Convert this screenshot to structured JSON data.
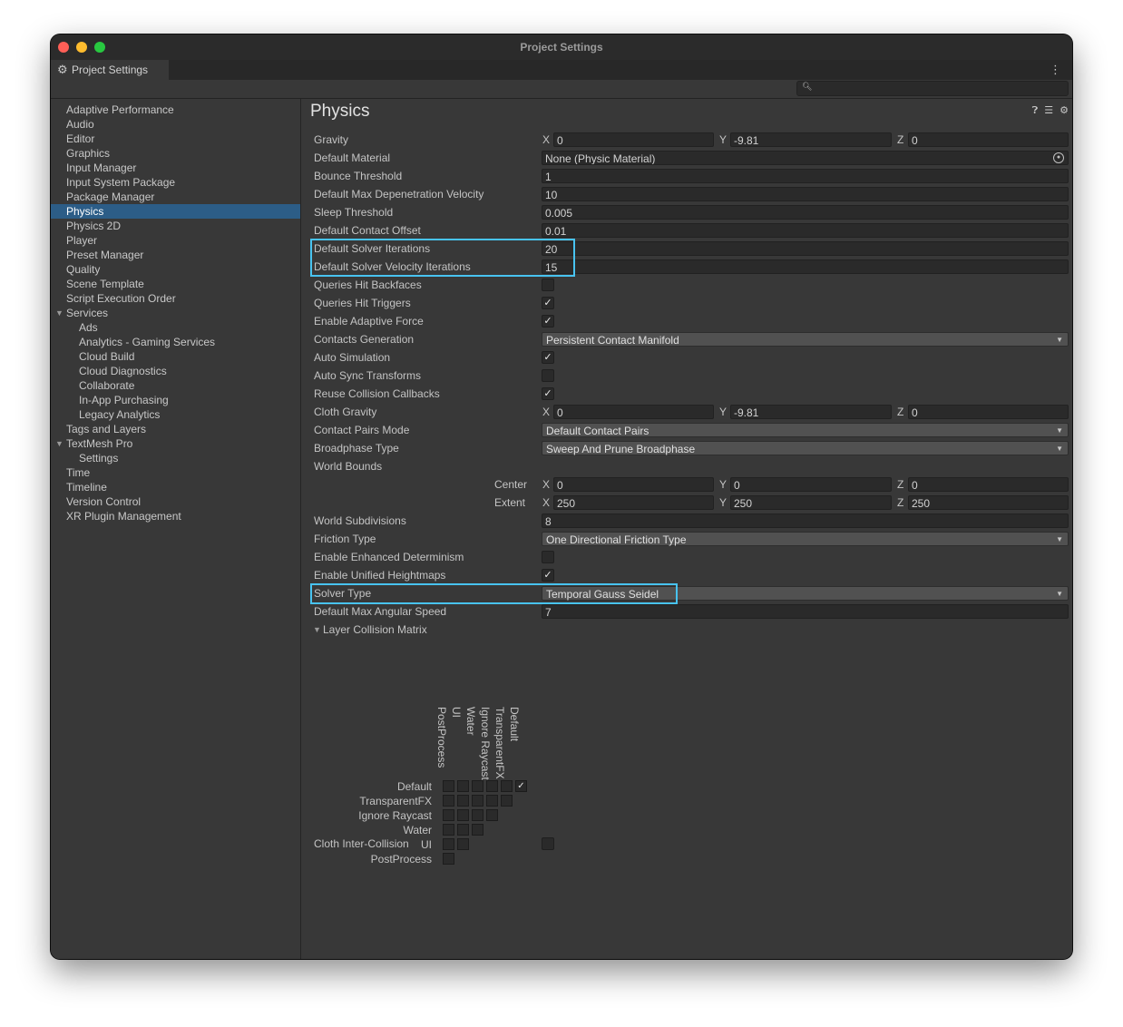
{
  "window": {
    "title": "Project Settings",
    "tab_label": "Project Settings"
  },
  "search": {
    "placeholder": ""
  },
  "sidebar": {
    "items": [
      {
        "label": "Adaptive Performance",
        "indent": 0
      },
      {
        "label": "Audio",
        "indent": 0
      },
      {
        "label": "Editor",
        "indent": 0
      },
      {
        "label": "Graphics",
        "indent": 0
      },
      {
        "label": "Input Manager",
        "indent": 0
      },
      {
        "label": "Input System Package",
        "indent": 0
      },
      {
        "label": "Package Manager",
        "indent": 0
      },
      {
        "label": "Physics",
        "indent": 0,
        "selected": true
      },
      {
        "label": "Physics 2D",
        "indent": 0
      },
      {
        "label": "Player",
        "indent": 0
      },
      {
        "label": "Preset Manager",
        "indent": 0
      },
      {
        "label": "Quality",
        "indent": 0
      },
      {
        "label": "Scene Template",
        "indent": 0
      },
      {
        "label": "Script Execution Order",
        "indent": 0
      },
      {
        "label": "Services",
        "indent": 0,
        "expanded": true
      },
      {
        "label": "Ads",
        "indent": 1
      },
      {
        "label": "Analytics - Gaming Services",
        "indent": 1
      },
      {
        "label": "Cloud Build",
        "indent": 1
      },
      {
        "label": "Cloud Diagnostics",
        "indent": 1
      },
      {
        "label": "Collaborate",
        "indent": 1
      },
      {
        "label": "In-App Purchasing",
        "indent": 1
      },
      {
        "label": "Legacy Analytics",
        "indent": 1
      },
      {
        "label": "Tags and Layers",
        "indent": 0
      },
      {
        "label": "TextMesh Pro",
        "indent": 0,
        "expanded": true
      },
      {
        "label": "Settings",
        "indent": 1
      },
      {
        "label": "Time",
        "indent": 0
      },
      {
        "label": "Timeline",
        "indent": 0
      },
      {
        "label": "Version Control",
        "indent": 0
      },
      {
        "label": "XR Plugin Management",
        "indent": 0
      }
    ]
  },
  "main": {
    "title": "Physics",
    "gravity": {
      "label": "Gravity",
      "x": "0",
      "y": "-9.81",
      "z": "0"
    },
    "default_material": {
      "label": "Default Material",
      "value": "None (Physic Material)"
    },
    "bounce_threshold": {
      "label": "Bounce Threshold",
      "value": "1"
    },
    "max_depenetration": {
      "label": "Default Max Depenetration Velocity",
      "value": "10"
    },
    "sleep_threshold": {
      "label": "Sleep Threshold",
      "value": "0.005"
    },
    "contact_offset": {
      "label": "Default Contact Offset",
      "value": "0.01"
    },
    "solver_iterations": {
      "label": "Default Solver Iterations",
      "value": "20"
    },
    "solver_velocity_iterations": {
      "label": "Default Solver Velocity Iterations",
      "value": "15"
    },
    "queries_hit_backfaces": {
      "label": "Queries Hit Backfaces",
      "checked": false
    },
    "queries_hit_triggers": {
      "label": "Queries Hit Triggers",
      "checked": true
    },
    "enable_adaptive_force": {
      "label": "Enable Adaptive Force",
      "checked": true
    },
    "contacts_generation": {
      "label": "Contacts Generation",
      "value": "Persistent Contact Manifold"
    },
    "auto_simulation": {
      "label": "Auto Simulation",
      "checked": true
    },
    "auto_sync_transforms": {
      "label": "Auto Sync Transforms",
      "checked": false
    },
    "reuse_collision_callbacks": {
      "label": "Reuse Collision Callbacks",
      "checked": true
    },
    "cloth_gravity": {
      "label": "Cloth Gravity",
      "x": "0",
      "y": "-9.81",
      "z": "0"
    },
    "contact_pairs_mode": {
      "label": "Contact Pairs Mode",
      "value": "Default Contact Pairs"
    },
    "broadphase_type": {
      "label": "Broadphase Type",
      "value": "Sweep And Prune Broadphase"
    },
    "world_bounds": {
      "label": "World Bounds",
      "center": {
        "label": "Center",
        "x": "0",
        "y": "0",
        "z": "0"
      },
      "extent": {
        "label": "Extent",
        "x": "250",
        "y": "250",
        "z": "250"
      }
    },
    "world_subdivisions": {
      "label": "World Subdivisions",
      "value": "8"
    },
    "friction_type": {
      "label": "Friction Type",
      "value": "One Directional Friction Type"
    },
    "enhanced_determinism": {
      "label": "Enable Enhanced Determinism",
      "checked": false
    },
    "unified_heightmaps": {
      "label": "Enable Unified Heightmaps",
      "checked": true
    },
    "solver_type": {
      "label": "Solver Type",
      "value": "Temporal Gauss Seidel"
    },
    "max_angular_speed": {
      "label": "Default Max Angular Speed",
      "value": "7"
    },
    "layer_collision_matrix": {
      "label": "Layer Collision Matrix",
      "columns": [
        "PostProcess",
        "UI",
        "Water",
        "Ignore Raycast",
        "TransparentFX",
        "Default"
      ],
      "rows": [
        "Default",
        "TransparentFX",
        "Ignore Raycast",
        "Water",
        "UI",
        "PostProcess"
      ],
      "checked": [
        [
          false,
          false,
          false,
          false,
          false,
          true
        ],
        [
          false,
          false,
          false,
          false,
          false
        ],
        [
          false,
          false,
          false,
          false
        ],
        [
          false,
          false,
          false
        ],
        [
          false,
          false
        ],
        [
          false
        ]
      ]
    },
    "cloth_inter_collision": {
      "label": "Cloth Inter-Collision",
      "checked": false
    },
    "axis_labels": {
      "x": "X",
      "y": "Y",
      "z": "Z"
    }
  },
  "colors": {
    "selection": "#2c5d87",
    "highlight": "#48c3f0",
    "background": "#383838"
  }
}
